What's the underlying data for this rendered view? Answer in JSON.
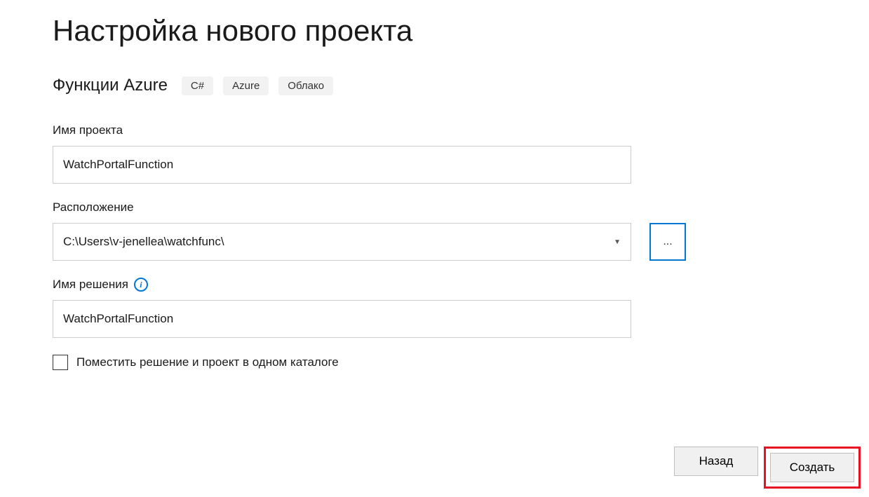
{
  "title": "Настройка нового проекта",
  "template": {
    "name": "Функции Azure",
    "tags": [
      "C#",
      "Azure",
      "Облако"
    ]
  },
  "fields": {
    "project_name": {
      "label": "Имя проекта",
      "value": "WatchPortalFunction"
    },
    "location": {
      "label": "Расположение",
      "value": "C:\\Users\\v-jenellea\\watchfunc\\",
      "browse_label": "..."
    },
    "solution_name": {
      "label": "Имя решения",
      "value": "WatchPortalFunction"
    },
    "same_directory": {
      "label": "Поместить решение и проект в одном каталоге",
      "checked": false
    }
  },
  "buttons": {
    "back": "Назад",
    "create": "Создать"
  }
}
